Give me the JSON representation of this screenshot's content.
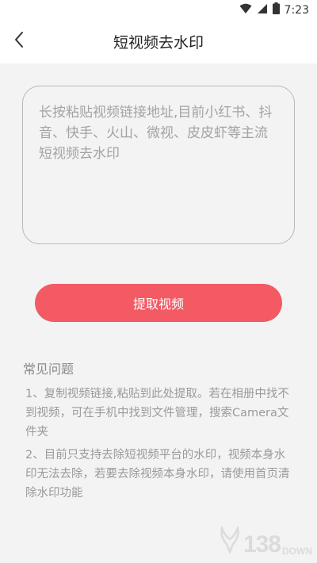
{
  "status_bar": {
    "time": "7:23",
    "icons": [
      "wifi-icon",
      "signal-icon",
      "battery-icon"
    ]
  },
  "header": {
    "back_icon": "chevron-left-icon",
    "title": "短视频去水印"
  },
  "input": {
    "placeholder": "长按粘贴视频链接地址,目前小红书、抖音、快手、火山、微视、皮皮虾等主流短视频去水印",
    "value": ""
  },
  "extract_button": {
    "label": "提取视频",
    "color": "#f35a64"
  },
  "faq": {
    "title": "常见问题",
    "items": [
      "1、复制视频链接,粘贴到此处提取。若在相册中找不到视频，可在手机中找到文件管理，搜索Camera文件夹",
      "2、目前只支持去除短视频平台的水印，视频本身水印无法去除，若要去除视频本身水印，请使用首页清除水印功能"
    ]
  },
  "watermark": {
    "number": "138",
    "suffix": "DOWN"
  },
  "colors": {
    "background": "#f3f3f3",
    "header_bg": "#ffffff",
    "accent": "#f35a64"
  }
}
